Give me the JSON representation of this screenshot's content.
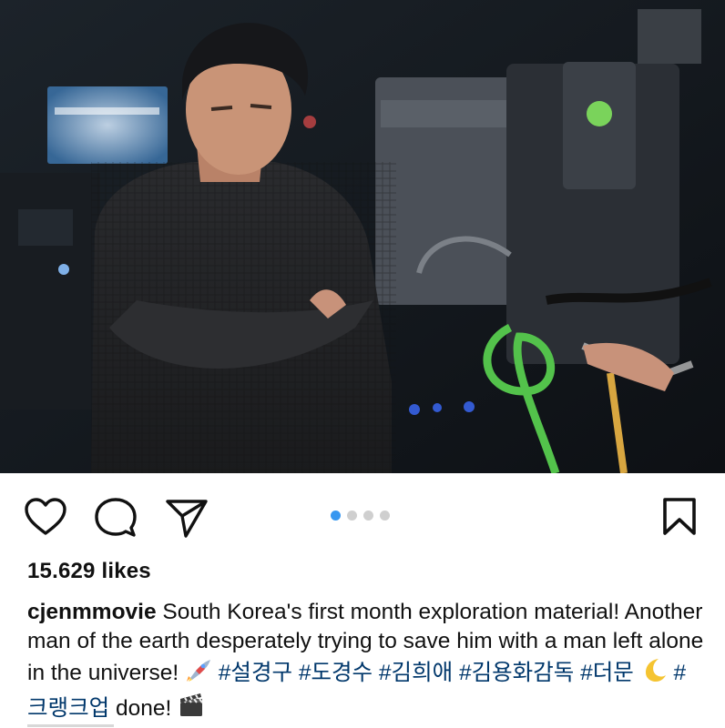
{
  "post": {
    "photo_icon": "photo",
    "carousel": {
      "count": 4,
      "active": 1
    },
    "likes_text": "15.629 likes",
    "caption": {
      "username": "cjenmmovie",
      "text_1": " South Korea's first month exploration material! Another man of the earth desperately trying to save him with a man left alone in the universe! ",
      "emoji_rocket": "rocket-emoji",
      "tag_1": "#설경구",
      "tag_2": "#도경수",
      "tag_3": "#김희애",
      "tag_4": "#김용화감독",
      "tag_5": "#더문",
      "emoji_moon": "crescent-moon-emoji",
      "tag_6": "#크랭크업",
      "text_2": " done! ",
      "emoji_clapper": "clapper-board-emoji"
    }
  },
  "colors": {
    "accent_dot": "#3797f0",
    "hashtag": "#00376b",
    "inactive_dot": "#cfcfcf"
  },
  "icons": {
    "like": "heart-icon",
    "comment": "comment-icon",
    "share": "paper-plane-icon",
    "save": "bookmark-icon"
  }
}
